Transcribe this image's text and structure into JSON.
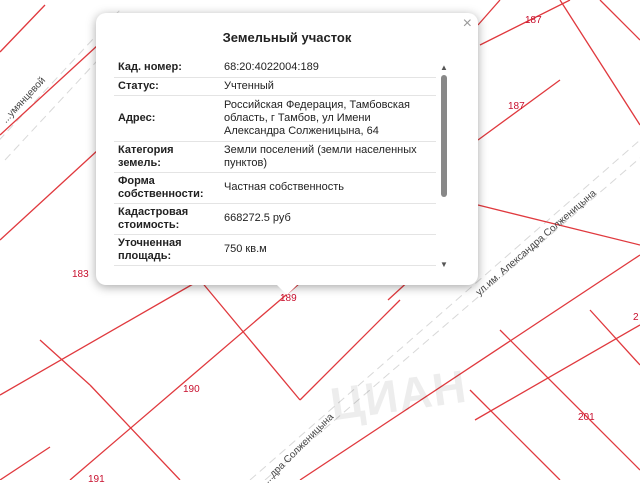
{
  "map": {
    "parcel_numbers": [
      "187",
      "187",
      "183",
      "189",
      "190",
      "201",
      "2",
      "191"
    ],
    "streets": [
      "...умянцевой",
      "ул.им. Александра Солженицына",
      "...дра Солженицына"
    ],
    "watermark": "ЦИАН",
    "colors": {
      "parcel_lines": "#e0393e",
      "parcel_numbers": "#c8102e",
      "road_dashes": "#d8d8d8"
    }
  },
  "popup": {
    "title": "Земельный участок",
    "close_icon": "close-icon",
    "rows": [
      {
        "label": "Кад. номер:",
        "value": "68:20:4022004:189"
      },
      {
        "label": "Статус:",
        "value": "Учтенный"
      },
      {
        "label": "Адрес:",
        "value": "Российская Федерация, Тамбовская область, г Тамбов, ул Имени Александра Солженицына, 64"
      },
      {
        "label": "Категория земель:",
        "value": "Земли поселений (земли населенных пунктов)"
      },
      {
        "label": "Форма собственности:",
        "value": "Частная собственность"
      },
      {
        "label": "Кадастровая стоимость:",
        "value": "668272.5 руб"
      },
      {
        "label": "Уточненная площадь:",
        "value": "750 кв.м"
      }
    ]
  }
}
